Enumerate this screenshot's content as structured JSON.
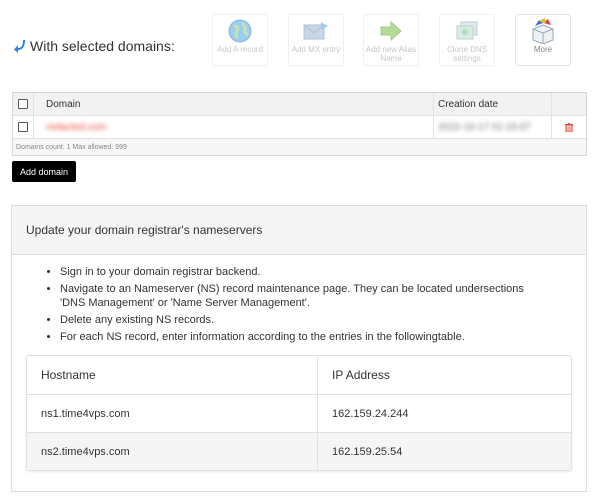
{
  "toolbar": {
    "label": "With selected domains:",
    "buttons": [
      {
        "label": "Add A record",
        "icon": "globe-icon"
      },
      {
        "label": "Add MX entry",
        "icon": "mail-icon"
      },
      {
        "label": "Add new Alias Name",
        "icon": "arrow-right-icon"
      },
      {
        "label": "Clone DNS settings",
        "icon": "clone-icon"
      },
      {
        "label": "More",
        "icon": "box-icon"
      }
    ]
  },
  "domains": {
    "columns": {
      "domain": "Domain",
      "created": "Creation date"
    },
    "rows": [
      {
        "domain": "redacted.com",
        "created": "2022-10-17 01:15:07"
      }
    ],
    "footer": "Domains count: 1 Max allowed: 999",
    "add_label": "Add domain"
  },
  "nameservers": {
    "title": "Update your domain registrar's nameservers",
    "steps": [
      "Sign in to your domain registrar backend.",
      "Navigate to an Nameserver (NS) record maintenance page. They can be located undersections 'DNS Management' or 'Name Server Management'.",
      "Delete any existing NS records.",
      "For each NS record, enter information according to the entries in the followingtable."
    ],
    "table": {
      "col_host": "Hostname",
      "col_ip": "IP Address",
      "rows": [
        {
          "host": "ns1.time4vps.com",
          "ip": "162.159.24.244"
        },
        {
          "host": "ns2.time4vps.com",
          "ip": "162.159.25.54"
        }
      ]
    }
  },
  "colors": {
    "accent": "#2e86de",
    "delete": "#e74c3c",
    "add_button_bg": "#000000"
  }
}
